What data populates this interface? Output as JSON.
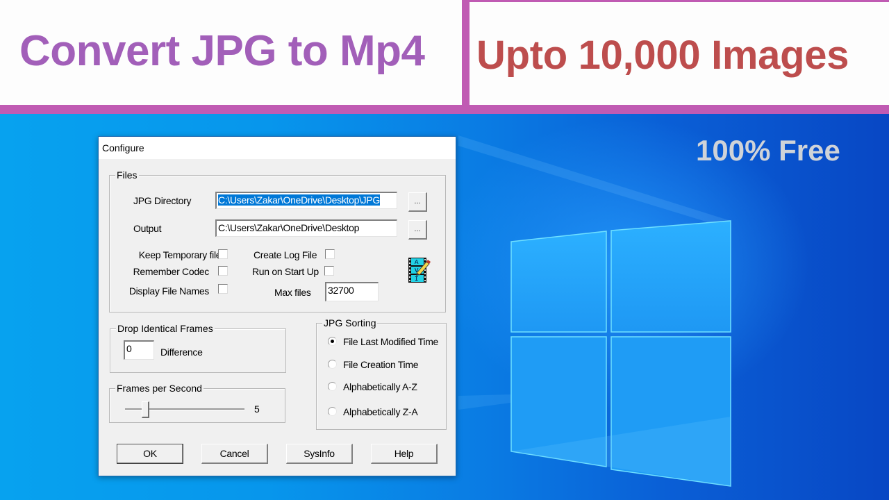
{
  "banner": {
    "headline_left": "Convert JPG to Mp4",
    "headline_right": "Upto 10,000 Images",
    "badge": "100% Free",
    "colors": {
      "accent_bar": "#c05bb3",
      "headline_left": "#a25fb9",
      "headline_right": "#bd4d4d",
      "badge": "#cfd3d8"
    }
  },
  "desktop": {
    "wallpaper": "windows-10-logo",
    "colors": {
      "light_blue": "#07a2ef",
      "dark_blue": "#0847c4",
      "logo_pane": "#24a8fb"
    }
  },
  "dialog": {
    "title": "Configure",
    "files_group": {
      "legend": "Files",
      "jpg_directory_label": "JPG Directory",
      "jpg_directory_value": "C:\\Users\\Zakar\\OneDrive\\Desktop\\JPG",
      "output_label": "Output",
      "output_value": "C:\\Users\\Zakar\\OneDrive\\Desktop",
      "browse_label": "...",
      "checkboxes": [
        {
          "label": "Keep Temporary files",
          "checked": false
        },
        {
          "label": "Remember Codec",
          "checked": false
        },
        {
          "label": "Display File Names",
          "checked": false
        },
        {
          "label": "Create Log File",
          "checked": false
        },
        {
          "label": "Run on Start Up",
          "checked": false
        }
      ],
      "max_files_label": "Max files",
      "max_files_value": "32700",
      "icon": "avi-edit-icon",
      "icon_letters": [
        "A",
        "V",
        "I"
      ]
    },
    "drop_identical": {
      "legend": "Drop Identical Frames",
      "value": "0",
      "unit_label": "Difference"
    },
    "fps": {
      "legend": "Frames per Second",
      "value": "5",
      "slider_fraction": 0.17
    },
    "sorting": {
      "legend": "JPG Sorting",
      "options": [
        {
          "label": "File Last Modified Time",
          "selected": true
        },
        {
          "label": "File Creation Time",
          "selected": false
        },
        {
          "label": "Alphabetically A-Z",
          "selected": false
        },
        {
          "label": "Alphabetically Z-A",
          "selected": false
        }
      ]
    },
    "buttons": {
      "ok": "OK",
      "cancel": "Cancel",
      "sysinfo": "SysInfo",
      "help": "Help"
    },
    "colors": {
      "selection": "#0078d7",
      "face": "#f0f0f0",
      "frame": "#1f6bb3"
    }
  }
}
